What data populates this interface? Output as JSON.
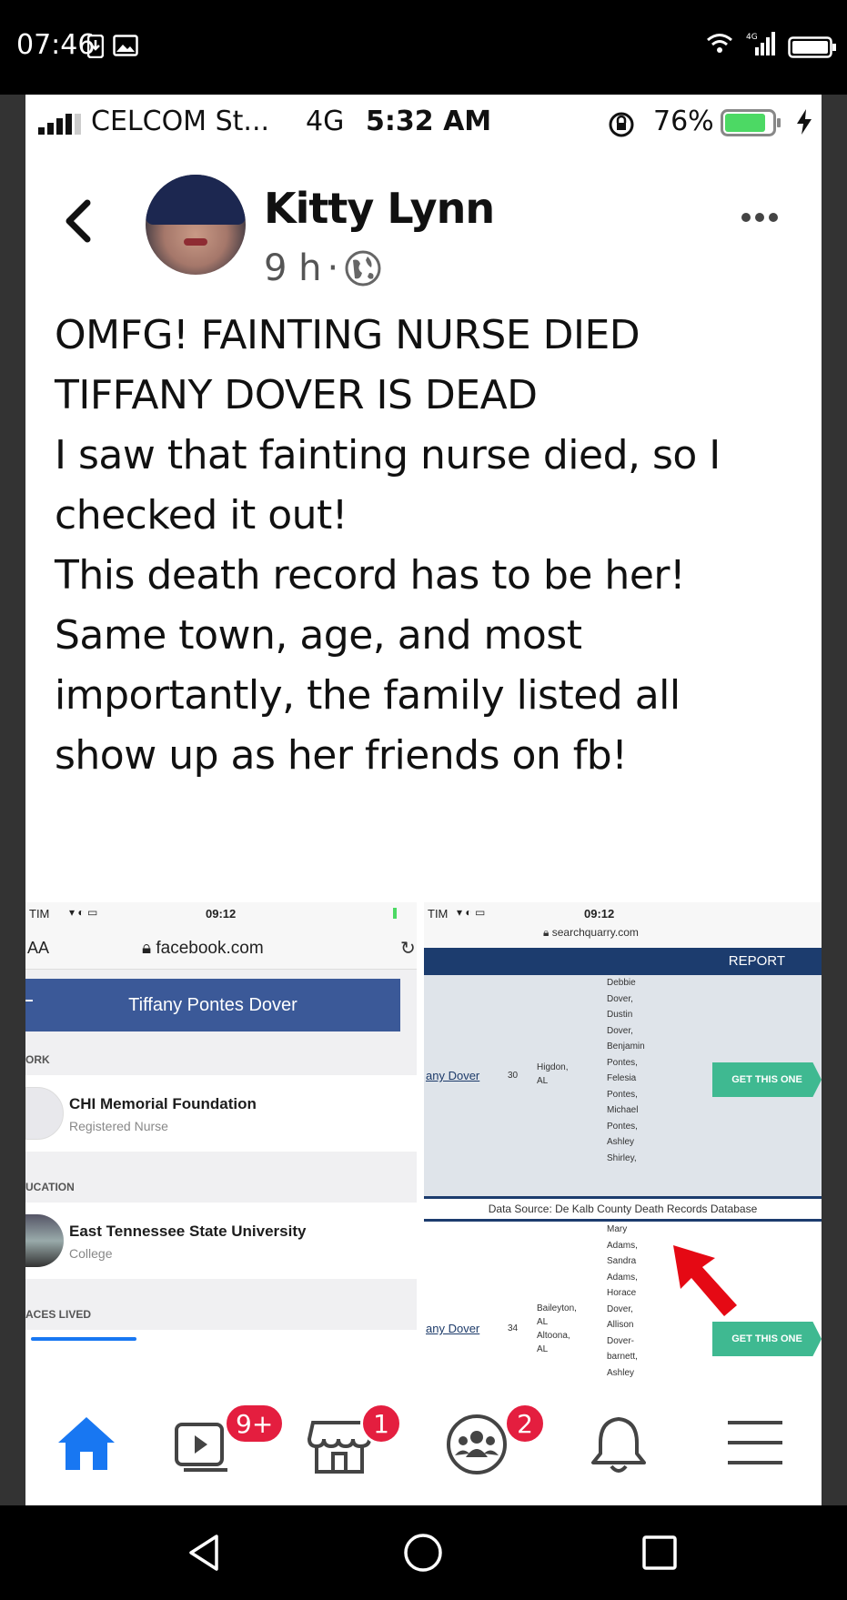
{
  "android_status": {
    "time": "07:46"
  },
  "ios_status": {
    "carrier": "CELCOM St...",
    "network": "4G",
    "time": "5:32 AM",
    "battery": "76%"
  },
  "post": {
    "author": "Kitty Lynn",
    "time": "9 h",
    "lines": [
      "OMFG! FAINTING NURSE DIED",
      "TIFFANY DOVER IS DEAD",
      "I saw that fainting nurse died, so I",
      "checked it out!",
      "This death record has to be her!",
      "Same town, age, and most",
      "importantly, the family listed all",
      "show up as her friends on fb!"
    ]
  },
  "left_shot": {
    "status_carrier": "TIM",
    "status_time": "09:12",
    "aa": "AA",
    "url": "facebook.com",
    "profile_name": "Tiffany Pontes Dover",
    "work_section": "ORK",
    "work_title": "CHI Memorial Foundation",
    "work_sub": "Registered Nurse",
    "edu_section": "UCATION",
    "edu_title": "East Tennessee State University",
    "edu_sub": "College",
    "places_section": "ACES LIVED"
  },
  "right_shot": {
    "status_carrier": "TIM",
    "status_time": "09:12",
    "url": "searchquarry.com",
    "report": "REPORT",
    "row1": {
      "name": "any Dover",
      "age": "30",
      "location": [
        "Higdon,",
        "AL"
      ],
      "relatives": [
        "Debbie",
        "Dover,",
        "Dustin",
        "Dover,",
        "Benjamin",
        "Pontes,",
        "Felesia",
        "Pontes,",
        "Michael",
        "Pontes,",
        "Ashley",
        "Shirley,"
      ],
      "button": "GET THIS ONE"
    },
    "data_source": "Data Source: De Kalb County Death Records Database",
    "row2": {
      "name": "any Dover",
      "age": "34",
      "location": [
        "Baileyton,",
        "AL",
        "Altoona,",
        "AL"
      ],
      "relatives": [
        "Mary",
        "Adams,",
        "Sandra",
        "Adams,",
        "Horace",
        "Dover,",
        "Allison",
        "Dover-",
        "barnett,",
        "Ashley"
      ],
      "button": "GET THIS ONE"
    }
  },
  "fb_nav": {
    "video_badge": "9+",
    "marketplace_badge": "1",
    "groups_badge": "2"
  },
  "colors": {
    "fb_blue": "#1877f2",
    "badge_red": "#e41e3f",
    "get_green": "#3fb991",
    "report_navy": "#1c3c6e"
  }
}
